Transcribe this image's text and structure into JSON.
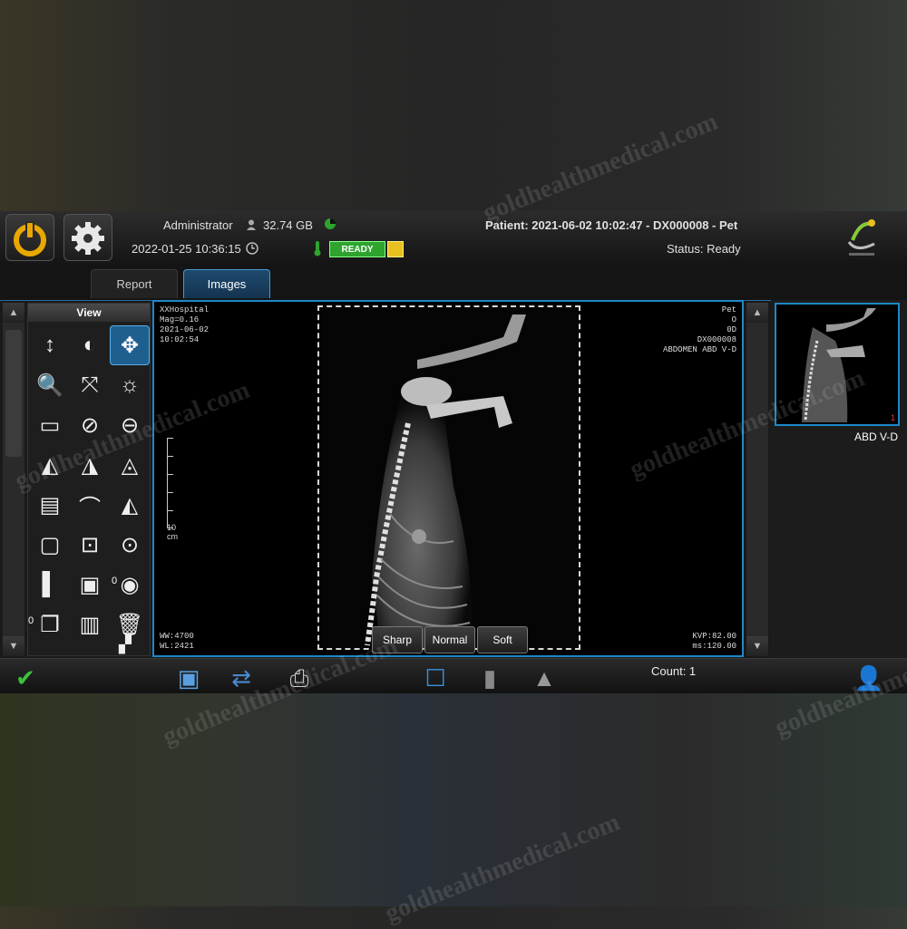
{
  "topbar": {
    "storage": "32.74 GB",
    "user": "Administrator",
    "patient": "Patient: 2021-06-02 10:02:47 - DX000008 - Pet",
    "datetime": "2022-01-25 10:36:15",
    "status": "Status: Ready",
    "ready_badge": "READY"
  },
  "tabs": [
    {
      "label": "Report",
      "active": false
    },
    {
      "label": "Images",
      "active": true
    }
  ],
  "tool_panel": {
    "title": "View",
    "tools": [
      {
        "icon": "vertical-move-icon",
        "glyph": "↕"
      },
      {
        "icon": "invert-icon",
        "glyph": "◐"
      },
      {
        "icon": "pan-icon",
        "glyph": "✥",
        "active": true
      },
      {
        "icon": "zoom-in-icon",
        "glyph": "🔍"
      },
      {
        "icon": "fit-icon",
        "glyph": "⤧"
      },
      {
        "icon": "brightness-icon",
        "glyph": "☼"
      },
      {
        "icon": "crop-icon",
        "glyph": "▭"
      },
      {
        "icon": "no-shutter-icon",
        "glyph": "⊘"
      },
      {
        "icon": "zoom-out-icon",
        "glyph": "⊖"
      },
      {
        "icon": "flip-horizontal-icon",
        "glyph": "◭"
      },
      {
        "icon": "flip-vertical-icon",
        "glyph": "◮"
      },
      {
        "icon": "mirror-icon",
        "glyph": "◬"
      },
      {
        "icon": "document-icon",
        "glyph": "▤"
      },
      {
        "icon": "rotate-icon",
        "glyph": "⌒"
      },
      {
        "icon": "mirror-right-icon",
        "glyph": "◭"
      },
      {
        "icon": "frame-icon",
        "glyph": "▢"
      },
      {
        "icon": "magnifier-frame-icon",
        "glyph": "⊡"
      },
      {
        "icon": "magnifier-icon",
        "glyph": "⊙"
      },
      {
        "icon": "contrast-icon",
        "glyph": "▌"
      },
      {
        "icon": "window-icon",
        "glyph": "▣"
      },
      {
        "icon": "eye-icon",
        "glyph": "◉"
      },
      {
        "icon": "copy-icon",
        "glyph": "❐"
      },
      {
        "icon": "pages-icon",
        "glyph": "▥"
      },
      {
        "icon": "trash-icon",
        "glyph": "🗑"
      }
    ],
    "counter_eye": "0",
    "counter_copy": "0"
  },
  "viewer": {
    "overlay_tl": [
      "XXHospital",
      "Mag=0.16",
      "2021-06-02",
      "10:02:54"
    ],
    "overlay_tr": [
      "Pet",
      "O",
      "0D",
      "DX000008",
      "ABDOMEN ABD V-D"
    ],
    "overlay_bl": [
      "WW:4700",
      "WL:2421"
    ],
    "overlay_br": [
      "KVP:82.00",
      "ms:120.00"
    ],
    "ruler_label": "10",
    "ruler_unit": "cm",
    "filters": [
      "Sharp",
      "Normal",
      "Soft"
    ]
  },
  "thumbnail": {
    "label": "ABD V-D",
    "index": "1"
  },
  "bottombar": {
    "count": "Count: 1"
  },
  "watermark": "goldhealthmedical.com",
  "colors": {
    "accent": "#1e88c8",
    "ready": "#2ea42e",
    "power": "#e8a800"
  }
}
